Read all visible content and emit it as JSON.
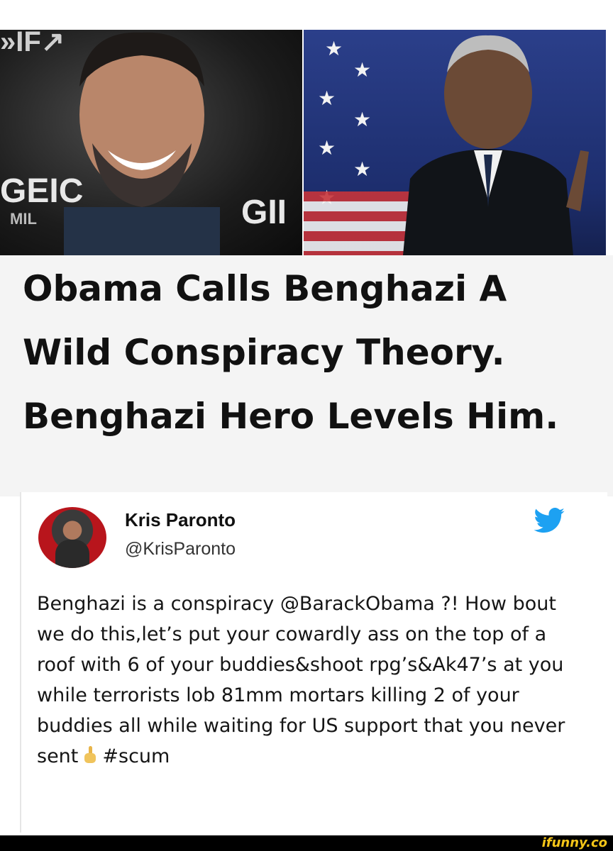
{
  "image_left": {
    "sponsor_text_top": "»IF↗",
    "sponsor_text_mid": "GEIC",
    "sponsor_text_small": "MIL",
    "sponsor_text_right": "GII"
  },
  "headline": "Obama Calls Benghazi A Wild Conspiracy Theory. Benghazi Hero Levels Him.",
  "tweet": {
    "author_name": "Kris Paronto",
    "author_handle": "@KrisParonto",
    "body_before_emoji": "Benghazi is a conspiracy @BarackObama ?! How bout we do this,let’s put your cowardly ass on the top of a roof with 6 of your buddies&shoot rpg’s&Ak47’s at you while terrorists lob 81mm mortars killing 2 of your buddies all while waiting for US support that you never sent",
    "body_after_emoji": "#scum",
    "emoji_icon": "middle-finger-icon",
    "platform_icon": "twitter-bird-icon",
    "platform_color": "#1da1f2"
  },
  "watermark": "ifunny.co"
}
